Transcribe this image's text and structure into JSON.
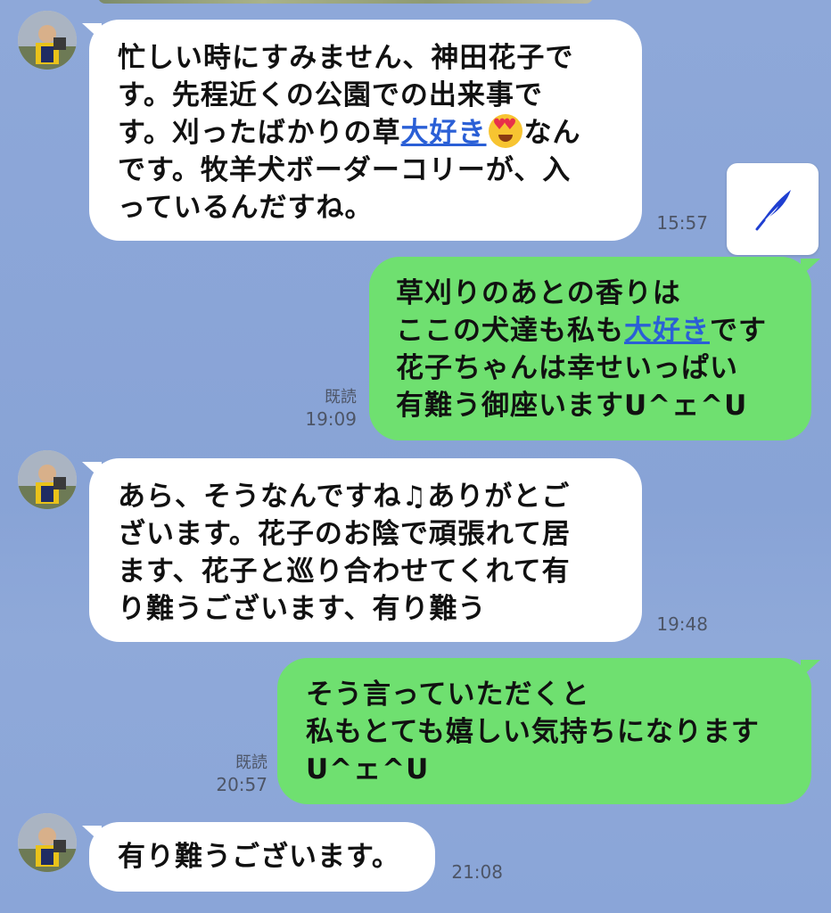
{
  "messages": [
    {
      "side": "in",
      "lines": [
        "忙しい時にすみません、神田花子で",
        "す。先程近くの公園での出来事で",
        {
          "before": "す。刈ったばかりの草",
          "link": "大好き",
          "emoji": "heart-eyes-emoji",
          "after": "なん"
        },
        "です。牧羊犬ボーダーコリーが、入",
        "っているんだすね。"
      ],
      "time": "15:57"
    },
    {
      "side": "out",
      "lines": [
        "草刈りのあとの香りは",
        {
          "before": "ここの犬達も私も",
          "link": "大好き",
          "after": "です"
        },
        "花子ちゃんは幸せいっぱい",
        "有難う御座いますU^ェ^U"
      ],
      "read": "既読",
      "time": "19:09"
    },
    {
      "side": "in",
      "lines": [
        {
          "before": "あら、そうなんですね",
          "note": "♫",
          "after": "ありがとご"
        },
        "ざいます。花子のお陰で頑張れて居",
        "ます、花子と巡り合わせてくれて有",
        "り難うございます、有り難う"
      ],
      "time": "19:48"
    },
    {
      "side": "out",
      "lines": [
        "そう言っていただくと",
        "私もとても嬉しい気持ちになります",
        "U^ェ^U"
      ],
      "read": "既読",
      "time": "20:57"
    },
    {
      "side": "in",
      "lines": [
        "有り難うございます。"
      ],
      "time": "21:08"
    }
  ],
  "icons": {
    "share_button": "quill-pen-icon",
    "avatar": "user-avatar"
  },
  "colors": {
    "background": "#8aa5d8",
    "incoming_bubble": "#ffffff",
    "outgoing_bubble": "#6fe070",
    "link": "#2a5fd6"
  }
}
